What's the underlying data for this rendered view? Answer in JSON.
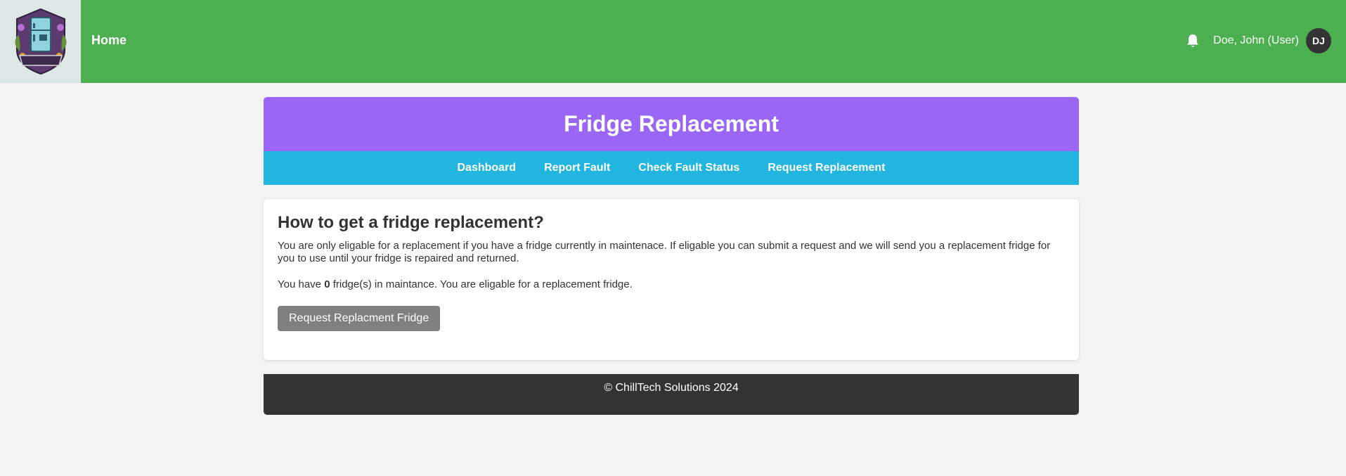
{
  "header": {
    "logo_text": "CHILLTECH",
    "home_label": "Home",
    "bell_icon": "bell-icon",
    "user_name": "Doe, John (User)",
    "avatar_initials": "DJ",
    "colors": {
      "header_bg": "#4caf50",
      "avatar_bg": "#333333"
    }
  },
  "page": {
    "title": "Fridge Replacement",
    "tabs": [
      {
        "label": "Dashboard"
      },
      {
        "label": "Report Fault"
      },
      {
        "label": "Check Fault Status"
      },
      {
        "label": "Request Replacement"
      }
    ],
    "colors": {
      "banner_bg": "#9966f5",
      "tabs_bg": "#22b5df"
    }
  },
  "card": {
    "heading": "How to get a fridge replacement?",
    "description": "You are only eligable for a replacement if you have a fridge currently in maintenace. If eligable you can submit a request and we will send you a replacement fridge for you to use until your fridge is repaired and returned.",
    "count_prefix": "You have ",
    "count_value": "0",
    "count_suffix": " fridge(s) in maintance. You are eligable for a replacement fridge.",
    "button_label": "Request Replacment Fridge",
    "button_color": "#808080"
  },
  "footer": {
    "text": "© ChillTech Solutions 2024"
  }
}
